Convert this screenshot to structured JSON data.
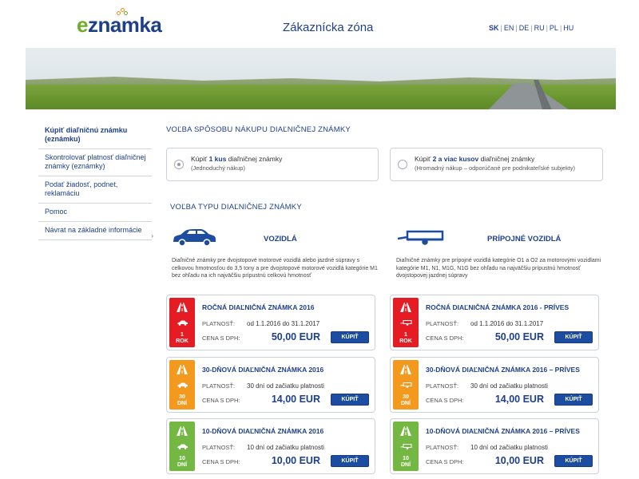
{
  "header": {
    "logo_text": "eznamka",
    "title": "Zákaznícka zóna",
    "languages": [
      "SK",
      "EN",
      "DE",
      "RU",
      "PL",
      "HU"
    ],
    "active_language": "SK"
  },
  "sidebar": {
    "items": [
      {
        "label": "Kúpiť diaľničnú známku (eznámku)"
      },
      {
        "label": "Skontrolovať platnosť diaľničnej známky (eznámky)"
      },
      {
        "label": "Podať žiadosť, podnet, reklamáciu"
      },
      {
        "label": "Pomoc"
      },
      {
        "label": "Návrat na základné informácie"
      }
    ],
    "arrow": "›"
  },
  "purchase": {
    "title": "VOĽBA SPÔSOBU NÁKUPU DIAĽNIČNEJ ZNÁMKY",
    "option1": {
      "pre": "Kúpiť ",
      "bold": "1 kus",
      "post": " diaľničnej známky",
      "sub": "(Jednoduchý nákup)",
      "selected": true
    },
    "option2": {
      "pre": "Kúpiť ",
      "bold": "2 a viac kusov",
      "post": " diaľničnej známky",
      "sub": "(Hromadný nákup – odporúčané pre podnikateľské subjekty)",
      "selected": false
    }
  },
  "type": {
    "title": "VOĽBA TYPU DIAĽNIČNEJ ZNÁMKY",
    "vehicles": {
      "title": "VOZIDLÁ",
      "icon": "car-icon",
      "desc": "Diaľničné známky pre dvojstopové motorové vozidlá alebo jazdné súpravy s celkovou hmotnosťou do 3,5 tony a pre dvojstopové motorové vozidlá kategórie M1 bez ohľadu na ich najväčšiu prípustnú celkovú hmotnosť"
    },
    "trailers": {
      "title": "PRÍPOJNÉ VOZIDLÁ",
      "icon": "trailer-icon",
      "desc": "Diaľničné známky pre prípojné vozidlá kategórie O1 a O2 za motorovými vozidlami kategórie M1, N1, M1G, N1G bez ohľadu na najväčšiu prípustnú hmotnosť dvojstopovej jazdnej súpravy"
    }
  },
  "labels": {
    "validity": "PLATNOSŤ:",
    "price": "CENA S DPH:",
    "buy": "KÚPIŤ"
  },
  "products": {
    "vehicles": [
      {
        "title": "ROČNÁ DIAĽNIČNÁ ZNÁMKA 2016",
        "badge_line1": "1",
        "badge_line2": "ROK",
        "validity": "od 1.1.2016 do 31.1.2017",
        "price": "50,00 EUR",
        "color": "#e51c24"
      },
      {
        "title": "30-DŇOVÁ DIAĽNIČNÁ ZNÁMKA 2016",
        "badge_line1": "30",
        "badge_line2": "DNÍ",
        "validity": "30 dní od začiatku platnosti",
        "price": "14,00 EUR",
        "color": "#f39a1e"
      },
      {
        "title": "10-DŇOVÁ DIAĽNIČNÁ ZNÁMKA 2016",
        "badge_line1": "10",
        "badge_line2": "DNÍ",
        "validity": "10 dní od začiatku platnosti",
        "price": "10,00 EUR",
        "color": "#74b843"
      }
    ],
    "trailers": [
      {
        "title": "ROČNÁ DIAĽNIČNÁ ZNÁMKA 2016 - PRÍVES",
        "badge_line1": "1",
        "badge_line2": "ROK",
        "validity": "od 1.1.2016 do 31.1.2017",
        "price": "50,00 EUR",
        "color": "#e51c24"
      },
      {
        "title": "30-DŇOVÁ DIAĽNIČNÁ ZNÁMKA 2016 – PRÍVES",
        "badge_line1": "30",
        "badge_line2": "DNÍ",
        "validity": "30 dní od začiatku platnosti",
        "price": "14,00 EUR",
        "color": "#f39a1e"
      },
      {
        "title": "10-DŇOVÁ DIAĽNIČNÁ ZNÁMKA 2016 – PRÍVES",
        "badge_line1": "10",
        "badge_line2": "DNÍ",
        "validity": "10 dní od začiatku platnosti",
        "price": "10,00 EUR",
        "color": "#74b843"
      }
    ]
  }
}
